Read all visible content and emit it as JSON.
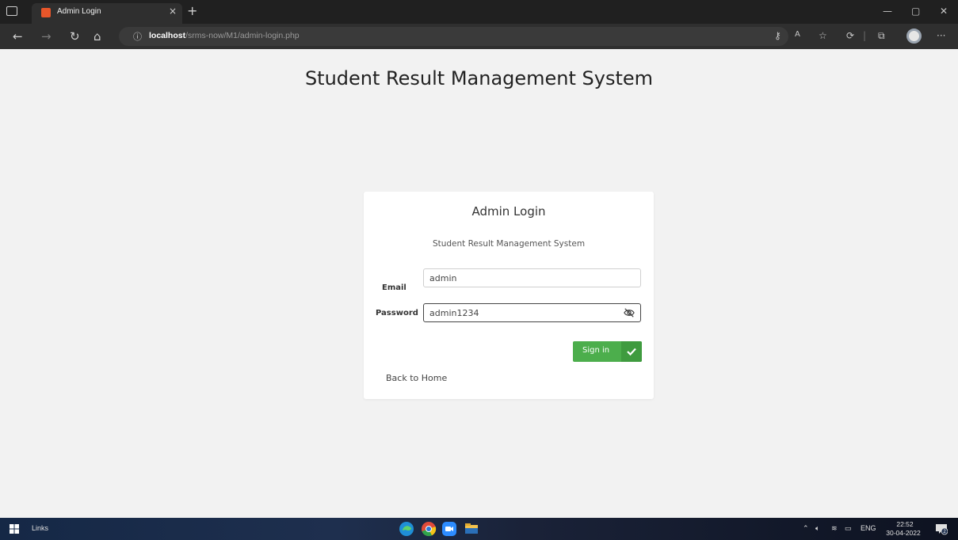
{
  "browser": {
    "tab_title": "Admin Login",
    "tab_close": "×",
    "new_tab": "+",
    "url_host": "localhost",
    "url_path": "/srms-now/M1/admin-login.php",
    "window_controls": {
      "minimize": "—",
      "restore": "▢",
      "close": "✕"
    }
  },
  "page": {
    "heading": "Student Result Management System"
  },
  "login": {
    "title": "Admin Login",
    "subtitle": "Student Result Management System",
    "email_label": "Email",
    "email_value": "admin",
    "password_label": "Password",
    "password_value": "admin1234",
    "submit_label": "Sign in",
    "back_link": "Back to Home"
  },
  "taskbar": {
    "links_label": "Links",
    "language": "ENG",
    "time": "22:52",
    "date": "30-04-2022",
    "notification_count": "2"
  },
  "colors": {
    "accent_green": "#4cae4c",
    "page_bg": "#f2f2f2"
  }
}
